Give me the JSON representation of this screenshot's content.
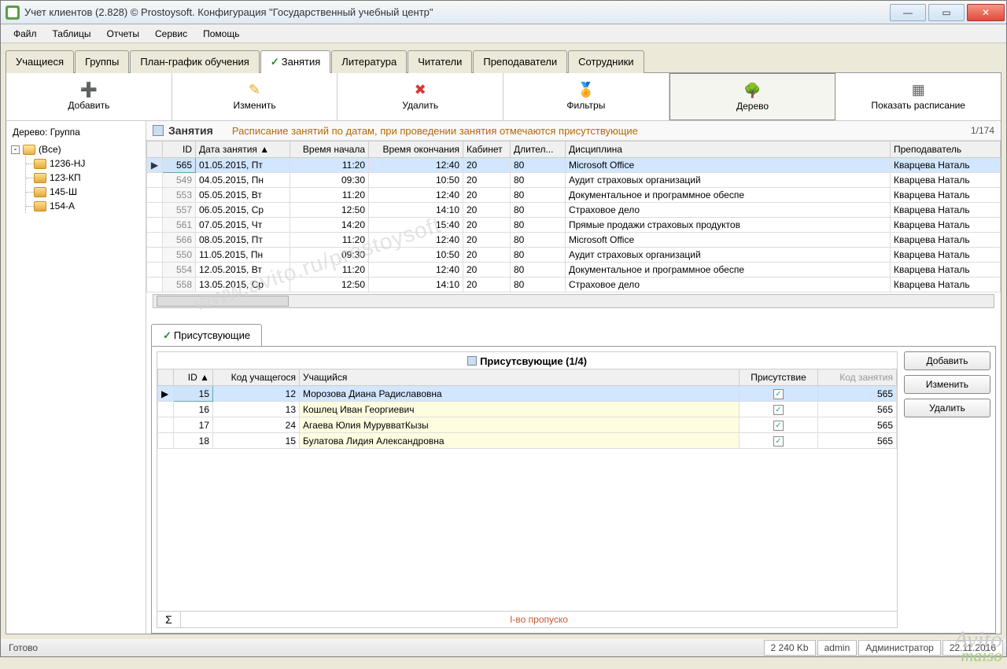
{
  "window": {
    "title": "Учет клиентов (2.828) © Prostoysoft. Конфигурация \"Государственный учебный центр\""
  },
  "menu": [
    "Файл",
    "Таблицы",
    "Отчеты",
    "Сервис",
    "Помощь"
  ],
  "tabs": [
    {
      "label": "Учащиеся",
      "active": false
    },
    {
      "label": "Группы",
      "active": false
    },
    {
      "label": "План-график обучения",
      "active": false
    },
    {
      "label": "Занятия",
      "active": true,
      "check": true
    },
    {
      "label": "Литература",
      "active": false
    },
    {
      "label": "Читатели",
      "active": false
    },
    {
      "label": "Преподаватели",
      "active": false
    },
    {
      "label": "Сотрудники",
      "active": false
    }
  ],
  "toolbar": [
    {
      "label": "Добавить",
      "icon": "➕",
      "color": "#2a8"
    },
    {
      "label": "Изменить",
      "icon": "✎",
      "color": "#e6a617"
    },
    {
      "label": "Удалить",
      "icon": "✖",
      "color": "#d33"
    },
    {
      "label": "Фильтры",
      "icon": "🏅",
      "color": "#39c"
    },
    {
      "label": "Дерево",
      "icon": "🌳",
      "color": "#c90",
      "active": true
    },
    {
      "label": "Показать расписание",
      "icon": "▦",
      "color": "#666"
    }
  ],
  "tree": {
    "title": "Дерево: Группа",
    "root": "(Все)",
    "children": [
      "1236-HJ",
      "123-КП",
      "145-Ш",
      "154-А"
    ]
  },
  "grid_header": {
    "title": "Занятия",
    "subtitle": "Расписание занятий по датам, при проведении занятия отмечаются присутствующие",
    "counter": "1/174"
  },
  "columns": [
    "",
    "ID",
    "Дата занятия ▲",
    "Время начала",
    "Время окончания",
    "Кабинет",
    "Длител...",
    "Дисциплина",
    "Преподаватель"
  ],
  "rows": [
    {
      "sel": true,
      "id": "565",
      "date": "01.05.2015, Пт",
      "start": "11:20",
      "end": "12:40",
      "room": "20",
      "dur": "80",
      "subj": "Microsoft Office",
      "teach": "Кварцева Наталь"
    },
    {
      "id": "549",
      "date": "04.05.2015, Пн",
      "start": "09:30",
      "end": "10:50",
      "room": "20",
      "dur": "80",
      "subj": "Аудит страховых организаций",
      "teach": "Кварцева Наталь"
    },
    {
      "id": "553",
      "date": "05.05.2015, Вт",
      "start": "11:20",
      "end": "12:40",
      "room": "20",
      "dur": "80",
      "subj": "Документальное и программное обеспе",
      "teach": "Кварцева Наталь"
    },
    {
      "id": "557",
      "date": "06.05.2015, Ср",
      "start": "12:50",
      "end": "14:10",
      "room": "20",
      "dur": "80",
      "subj": "Страховое дело",
      "teach": "Кварцева Наталь"
    },
    {
      "id": "561",
      "date": "07.05.2015, Чт",
      "start": "14:20",
      "end": "15:40",
      "room": "20",
      "dur": "80",
      "subj": "Прямые продажи страховых продуктов",
      "teach": "Кварцева Наталь"
    },
    {
      "id": "566",
      "date": "08.05.2015, Пт",
      "start": "11:20",
      "end": "12:40",
      "room": "20",
      "dur": "80",
      "subj": "Microsoft Office",
      "teach": "Кварцева Наталь"
    },
    {
      "id": "550",
      "date": "11.05.2015, Пн",
      "start": "09:30",
      "end": "10:50",
      "room": "20",
      "dur": "80",
      "subj": "Аудит страховых организаций",
      "teach": "Кварцева Наталь"
    },
    {
      "id": "554",
      "date": "12.05.2015, Вт",
      "start": "11:20",
      "end": "12:40",
      "room": "20",
      "dur": "80",
      "subj": "Документальное и программное обеспе",
      "teach": "Кварцева Наталь"
    },
    {
      "id": "558",
      "date": "13.05.2015, Ср",
      "start": "12:50",
      "end": "14:10",
      "room": "20",
      "dur": "80",
      "subj": "Страховое дело",
      "teach": "Кварцева Наталь"
    }
  ],
  "att_tab": "Присутсвующие",
  "att_header": "Присутсвующие (1/4)",
  "att_cols": [
    "",
    "ID ▲",
    "Код учащегося",
    "Учащийся",
    "Присутствие",
    "Код занятия"
  ],
  "att_rows": [
    {
      "sel": true,
      "id": "15",
      "kod": "12",
      "name": "Морозова Диана Радиславовна",
      "pres": true,
      "les": "565"
    },
    {
      "alt": true,
      "id": "16",
      "kod": "13",
      "name": "Кошлец Иван Георгиевич",
      "pres": true,
      "les": "565"
    },
    {
      "alt": true,
      "id": "17",
      "kod": "24",
      "name": "Агаева Юлия МурувватКызы",
      "pres": true,
      "les": "565"
    },
    {
      "alt": true,
      "id": "18",
      "kod": "15",
      "name": "Булатова Лидия Александровна",
      "pres": true,
      "les": "565"
    }
  ],
  "att_footer_label": "I-во пропуско",
  "att_buttons": [
    "Добавить",
    "Изменить",
    "Удалить"
  ],
  "status": {
    "ready": "Готово",
    "mem": "2 240 Kb",
    "user": "admin",
    "role": "Администратор",
    "date": "22.11.2016"
  },
  "watermark": {
    "l1": "Avito",
    "l2": "maiso",
    "diag": "www.avito.ru/prostoysoft"
  }
}
